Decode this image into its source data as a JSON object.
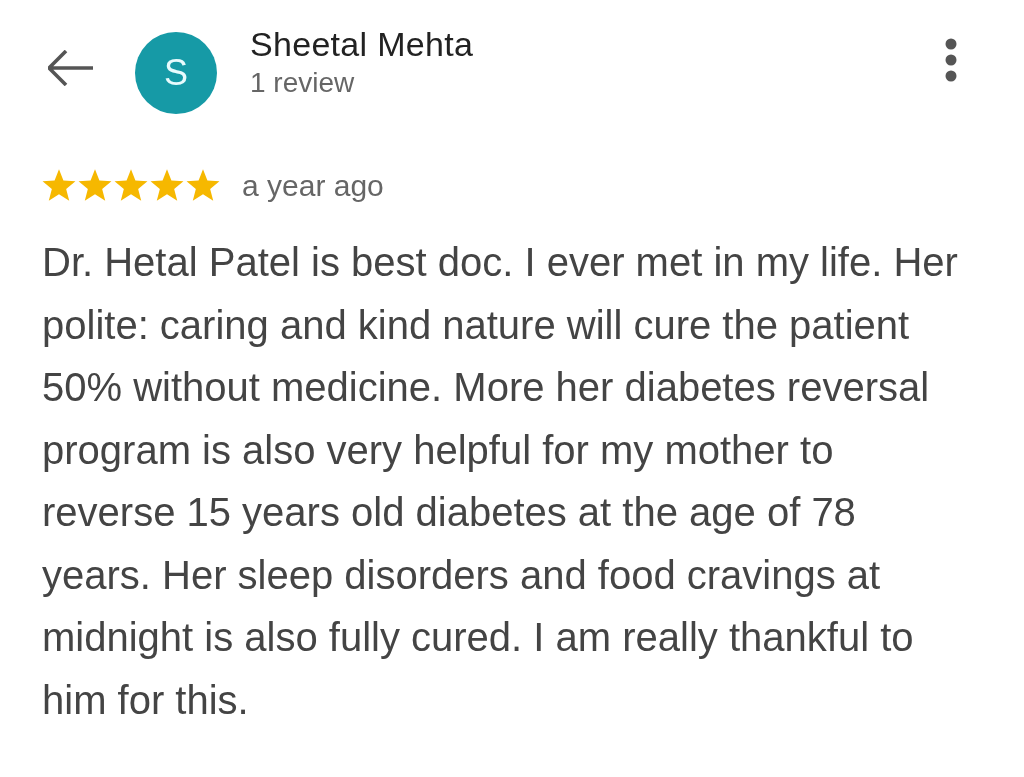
{
  "header": {
    "name": "Sheetal Mehta",
    "avatar_letter": "S",
    "review_count": "1 review"
  },
  "review": {
    "stars": 5,
    "time": "a year ago",
    "text": "Dr. Hetal Patel is best doc. I ever met in my life. Her polite: caring and kind nature will cure the patient 50% without medicine. More her diabetes reversal program is also very helpful for my mother to reverse 15 years old diabetes at the age of 78 years. Her sleep disorders and food cravings at midnight is also fully cured. I am really thankful to him for this."
  }
}
